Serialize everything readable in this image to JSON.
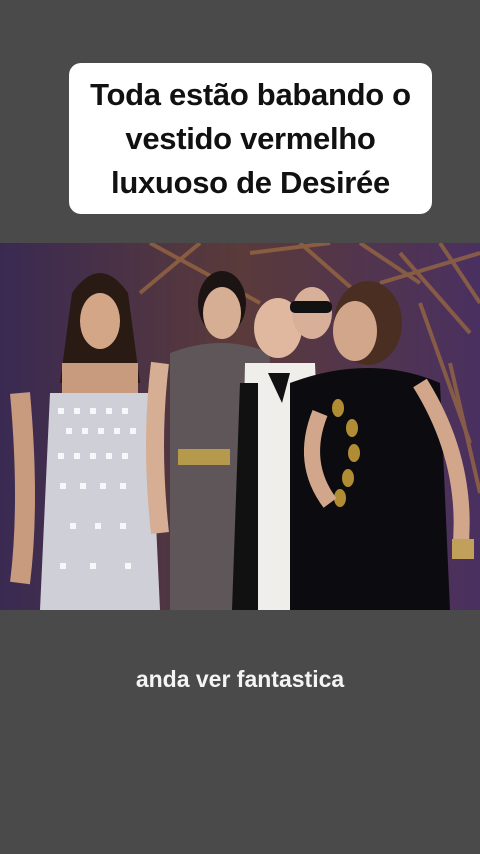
{
  "caption": {
    "text": "Toda estão babando o\nvestido vermelho\nluxuoso de Desirée"
  },
  "video": {
    "subtitle": "anda ver fantastica"
  },
  "colors": {
    "background": "#4a4a4a",
    "card": "#ffffff",
    "subtitle_text": "#f4f4f4"
  }
}
